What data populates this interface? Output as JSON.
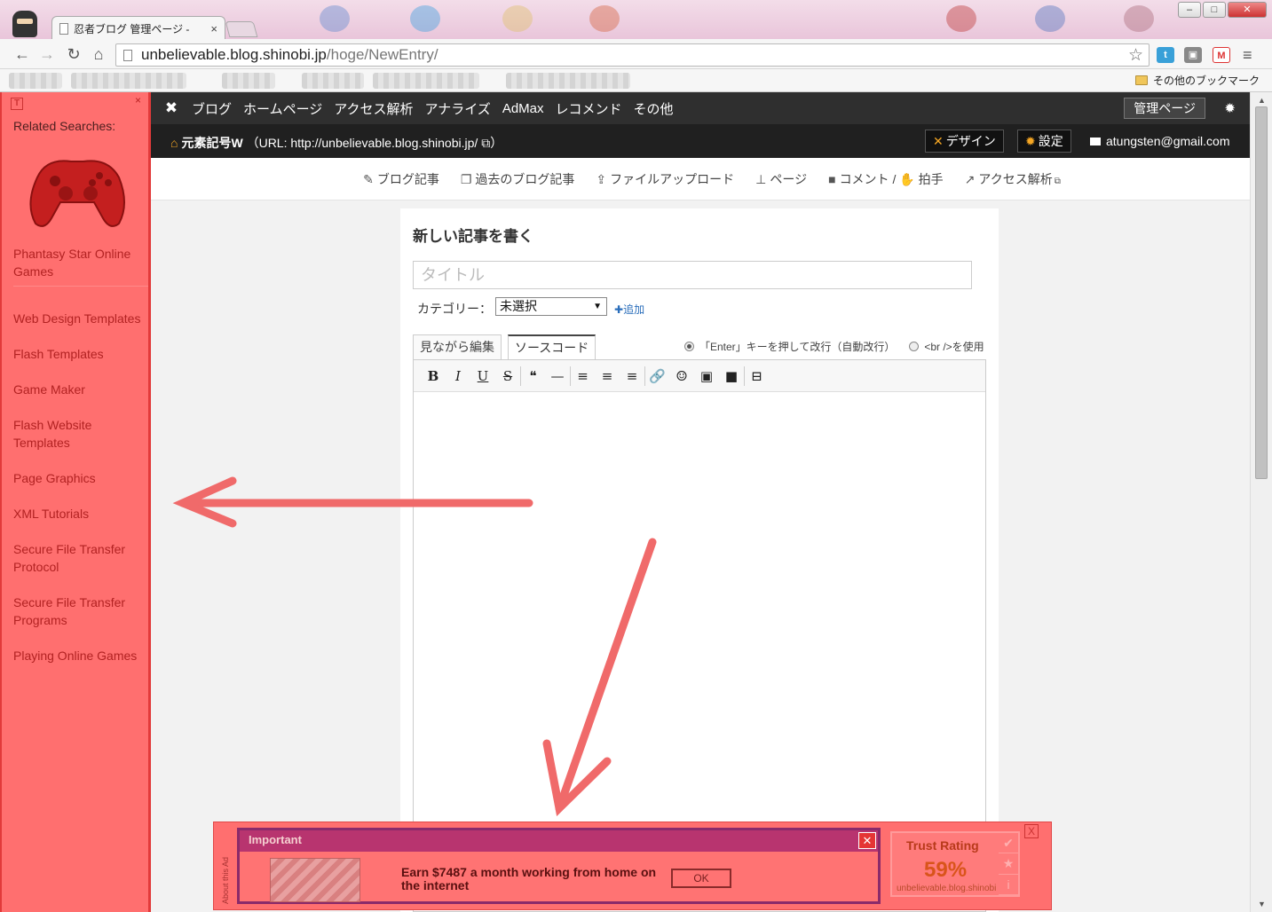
{
  "browser": {
    "tab_title": "忍者ブログ 管理ページ -",
    "tab_close": "×",
    "url_host": "unbelievable.blog.shinobi.jp",
    "url_path": "/hoge/NewEntry/",
    "other_bookmarks": "その他のブックマーク",
    "window_buttons": [
      "–",
      "□",
      "✕"
    ],
    "nav_icons": [
      "back-arrow-icon",
      "forward-arrow-icon",
      "reload-icon",
      "home-icon"
    ]
  },
  "ad_sidebar": {
    "heading": "Related Searches:",
    "close": "×",
    "logo": "T",
    "links": [
      "Phantasy Star Online Games",
      "Web Design Templates",
      "Flash Templates",
      "Game Maker",
      "Flash Website Templates",
      "Page Graphics",
      "XML Tutorials",
      "Secure File Transfer Protocol",
      "Secure File Transfer Programs",
      "Playing Online Games"
    ]
  },
  "admin_nav": {
    "items": [
      "ブログ",
      "ホームページ",
      "アクセス解析",
      "アナライズ",
      "AdMax",
      "レコメンド",
      "その他"
    ],
    "admin_page": "管理ページ"
  },
  "blog_bar": {
    "name": "元素記号W",
    "url_text": "（URL: http://unbelievable.blog.shinobi.jp/",
    "url_end": "）",
    "design": "デザイン",
    "settings": "設定",
    "account": "atungsten@gmail.com"
  },
  "subnav": {
    "items": [
      "ブログ記事",
      "過去のブログ記事",
      "ファイルアップロード",
      "ページ",
      "コメント /",
      "拍手",
      "アクセス解析"
    ]
  },
  "editor": {
    "heading": "新しい記事を書く",
    "title_placeholder": "タイトル",
    "category_label": "カテゴリー：",
    "category_value": "未選択",
    "add_label": "追加",
    "tab_wysiwyg": "見ながら編集",
    "tab_source": "ソースコード",
    "radio_enter": "「Enter」キーを押して改行（自動改行）",
    "radio_br": "<br />を使用",
    "toolbar": [
      "B",
      "I",
      "U",
      "S",
      "❝",
      "—",
      "≡",
      "≡",
      "≡",
      "🔗",
      "☺",
      "▣",
      "■",
      "⊟"
    ]
  },
  "bottom_ad": {
    "about": "About this Ad",
    "header": "Important",
    "message": "Earn $7487 a month working from home on the internet",
    "ok": "OK",
    "trust_title": "Trust Rating",
    "trust_value": "59%",
    "trust_site": "unbelievable.blog.shinobi.jp",
    "close": "X"
  },
  "colors": {
    "ad_red": "#ff6f6f",
    "nav_dark": "#2f2f2f",
    "annotation_arrow": "#f06a6a"
  }
}
